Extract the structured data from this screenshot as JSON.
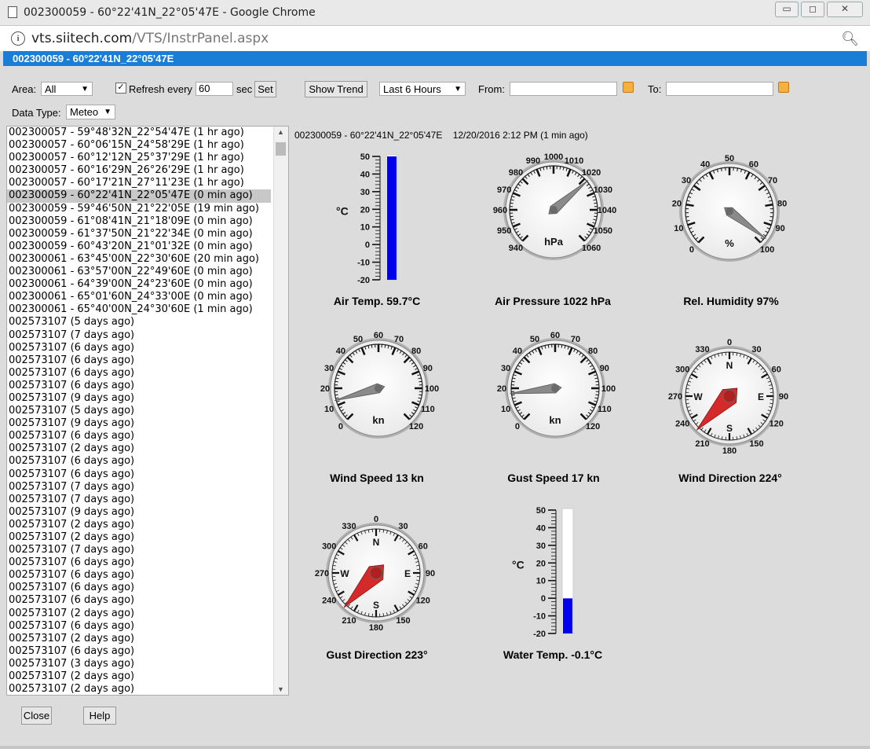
{
  "window": {
    "title": "002300059 - 60°22'41N_22°05'47E - Google Chrome",
    "buttons": {
      "minimize": "▭",
      "restore": "◻",
      "close": "✕"
    }
  },
  "address": {
    "host": "vts.siitech.com",
    "path": "/VTS/InstrPanel.aspx"
  },
  "header": {
    "title": "002300059 - 60°22'41N_22°05'47E"
  },
  "controls": {
    "area_label": "Area:",
    "area_value": "All",
    "refresh_label": "Refresh every",
    "refresh_value": "60",
    "sec_label": "sec",
    "set_button": "Set",
    "show_trend_button": "Show Trend",
    "range_value": "Last 6 Hours",
    "from_label": "From:",
    "to_label": "To:",
    "datatype_label": "Data Type:",
    "datatype_value": "Meteo"
  },
  "stations": [
    "002300057 - 59°48'32N_22°54'47E (1 hr ago)",
    "002300057 - 60°06'15N_24°58'29E (1 hr ago)",
    "002300057 - 60°12'12N_25°37'29E (1 hr ago)",
    "002300057 - 60°16'29N_26°26'29E (1 hr ago)",
    "002300057 - 60°17'21N_27°11'23E (1 hr ago)",
    "002300059 - 60°22'41N_22°05'47E (0 min ago)",
    "002300059 - 59°46'50N_21°22'05E (19 min ago)",
    "002300059 - 61°08'41N_21°18'09E (0 min ago)",
    "002300059 - 61°37'50N_21°22'34E (0 min ago)",
    "002300059 - 60°43'20N_21°01'32E (0 min ago)",
    "002300061 - 63°45'00N_22°30'60E (20 min ago)",
    "002300061 - 63°57'00N_22°49'60E (0 min ago)",
    "002300061 - 64°39'00N_24°23'60E (0 min ago)",
    "002300061 - 65°01'60N_24°33'00E (0 min ago)",
    "002300061 - 65°40'00N_24°30'60E (1 min ago)",
    "002573107 (5 days ago)",
    "002573107 (7 days ago)",
    "002573107 (6 days ago)",
    "002573107 (6 days ago)",
    "002573107 (6 days ago)",
    "002573107 (6 days ago)",
    "002573107 (9 days ago)",
    "002573107 (5 days ago)",
    "002573107 (9 days ago)",
    "002573107 (6 days ago)",
    "002573107 (2 days ago)",
    "002573107 (6 days ago)",
    "002573107 (6 days ago)",
    "002573107 (7 days ago)",
    "002573107 (7 days ago)",
    "002573107 (9 days ago)",
    "002573107 (2 days ago)",
    "002573107 (2 days ago)",
    "002573107 (7 days ago)",
    "002573107 (6 days ago)",
    "002573107 (6 days ago)",
    "002573107 (6 days ago)",
    "002573107 (6 days ago)",
    "002573107 (2 days ago)",
    "002573107 (6 days ago)",
    "002573107 (2 days ago)",
    "002573107 (6 days ago)",
    "002573107 (3 days ago)",
    "002573107 (2 days ago)",
    "002573107 (2 days ago)"
  ],
  "selected_station_index": 5,
  "panel": {
    "station": "002300059 - 60°22'41N_22°05'47E",
    "timestamp": "12/20/2016 2:12 PM (1 min ago)"
  },
  "gauges": {
    "air_temp": {
      "label": "Air Temp. 59.7°C",
      "unit": "°C",
      "value": 59.7,
      "min": -20,
      "max": 50,
      "ticks": [
        "50",
        "40",
        "30",
        "20",
        "10",
        "0",
        "-10",
        "-20"
      ]
    },
    "air_pressure": {
      "label": "Air Pressure 1022 hPa",
      "unit": "hPa",
      "value": 1022,
      "ticks": [
        "940",
        "950",
        "960",
        "970",
        "980",
        "990",
        "1000",
        "1010",
        "1020",
        "1030",
        "1040",
        "1050",
        "1060"
      ]
    },
    "humidity": {
      "label": "Rel. Humidity 97%",
      "unit": "%",
      "value": 97,
      "ticks": [
        "0",
        "10",
        "20",
        "30",
        "40",
        "50",
        "60",
        "70",
        "80",
        "90",
        "100"
      ]
    },
    "wind_speed": {
      "label": "Wind Speed 13 kn",
      "unit": "kn",
      "value": 13,
      "ticks": [
        "0",
        "10",
        "20",
        "30",
        "40",
        "50",
        "60",
        "70",
        "80",
        "90",
        "100",
        "110",
        "120"
      ]
    },
    "gust_speed": {
      "label": "Gust Speed 17 kn",
      "unit": "kn",
      "value": 17,
      "ticks": [
        "0",
        "10",
        "20",
        "30",
        "40",
        "50",
        "60",
        "70",
        "80",
        "90",
        "100",
        "110",
        "120"
      ]
    },
    "wind_dir": {
      "label": "Wind Direction 224°",
      "value": 224,
      "degrees": [
        "0",
        "30",
        "60",
        "90",
        "120",
        "150",
        "180",
        "210",
        "240",
        "270",
        "300",
        "330"
      ],
      "cardinals": [
        "N",
        "E",
        "S",
        "W"
      ]
    },
    "gust_dir": {
      "label": "Gust Direction 223°",
      "value": 223,
      "degrees": [
        "0",
        "30",
        "60",
        "90",
        "120",
        "150",
        "180",
        "210",
        "240",
        "270",
        "300",
        "330"
      ],
      "cardinals": [
        "N",
        "E",
        "S",
        "W"
      ]
    },
    "water_temp": {
      "label": "Water Temp. -0.1°C",
      "unit": "°C",
      "value": -0.1,
      "min": -20,
      "max": 50,
      "ticks": [
        "50",
        "40",
        "30",
        "20",
        "10",
        "0",
        "-10",
        "-20"
      ]
    }
  },
  "footer": {
    "close_button": "Close",
    "help_button": "Help"
  },
  "colors": {
    "header": "#1b7ed6",
    "bar": "#0000ee",
    "needle_red": "#d42a2a"
  }
}
